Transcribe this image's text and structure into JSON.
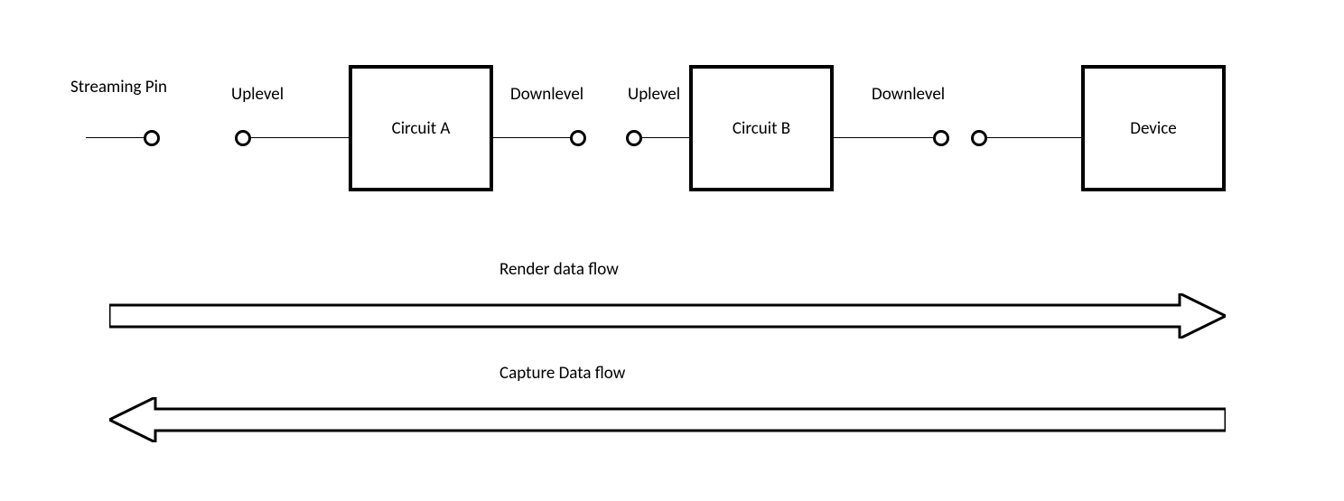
{
  "labels": {
    "streaming_pin": "Streaming Pin",
    "uplevel_1": "Uplevel",
    "circuit_a": "Circuit A",
    "downlevel_1": "Downlevel",
    "uplevel_2": "Uplevel",
    "circuit_b": "Circuit B",
    "downlevel_2": "Downlevel",
    "device": "Device"
  },
  "flows": {
    "render": "Render data flow",
    "capture": "Capture Data flow"
  }
}
